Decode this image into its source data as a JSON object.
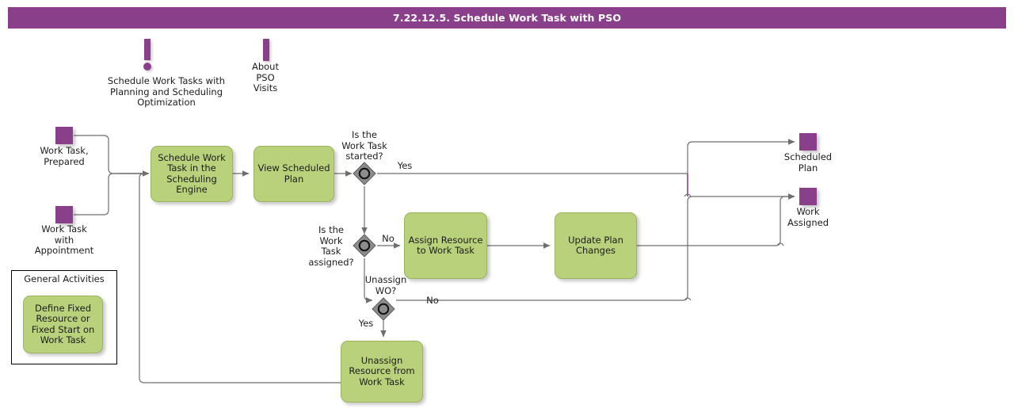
{
  "header": {
    "title": "7.22.12.5. Schedule Work Task with PSO",
    "bar_color": "#8a3f8a",
    "text_color": "#ffffff"
  },
  "palette": {
    "task_fill": "#b9d17a",
    "task_stroke": "#9cb45c",
    "event_fill": "#8a3f8a",
    "gateway_fill": "#8c8c8c",
    "connector": "#6e6e6e",
    "highlight": "#8a3f8a",
    "group_stroke": "#000000"
  },
  "annotations": [
    {
      "id": "schedule-work-tasks-pso",
      "icon": "exclamation-icon",
      "label": "Schedule Work Tasks with\nPlanning and Scheduling\nOptimization"
    },
    {
      "id": "about-pso-visits",
      "icon": "exclamation-icon",
      "label": "About\nPSO\nVisits"
    }
  ],
  "start_events": [
    {
      "id": "work-task-prepared",
      "label": "Work Task,\nPrepared"
    },
    {
      "id": "work-task-with-appointment",
      "label": "Work Task\nwith\nAppointment"
    }
  ],
  "end_events": [
    {
      "id": "scheduled-plan",
      "label": "Scheduled\nPlan"
    },
    {
      "id": "work-assigned",
      "label": "Work\nAssigned"
    }
  ],
  "tasks": [
    {
      "id": "schedule-work-task-in-scheduling-engine",
      "label": "Schedule Work\nTask in the\nScheduling\nEngine"
    },
    {
      "id": "view-scheduled-plan",
      "label": "View\nScheduled\nPlan"
    },
    {
      "id": "assign-resource-to-work-task",
      "label": "Assign Resource\nto Work Task"
    },
    {
      "id": "update-plan-changes",
      "label": "Update Plan\nChanges"
    },
    {
      "id": "unassign-resource-from-work-task",
      "label": "Unassign\nResource from\nWork Task"
    },
    {
      "id": "define-fixed-resource-or-fixed-start",
      "label": "Define Fixed\nResource or\nFixed Start on\nWork Task"
    }
  ],
  "gateways": [
    {
      "id": "is-work-task-started",
      "label": "Is the\nWork Task\nstarted?",
      "type": "event-based"
    },
    {
      "id": "is-work-task-assigned",
      "label": "Is the\nWork\nTask\nassigned?",
      "type": "event-based"
    },
    {
      "id": "unassign-wo",
      "label": "Unassign\nWO?",
      "type": "event-based"
    }
  ],
  "flow_labels": [
    {
      "id": "started-yes",
      "text": "Yes"
    },
    {
      "id": "assigned-no",
      "text": "No"
    },
    {
      "id": "unassign-no",
      "text": "No"
    },
    {
      "id": "unassign-yes",
      "text": "Yes"
    }
  ],
  "groups": [
    {
      "id": "general-activities",
      "title": "General Activities"
    }
  ]
}
